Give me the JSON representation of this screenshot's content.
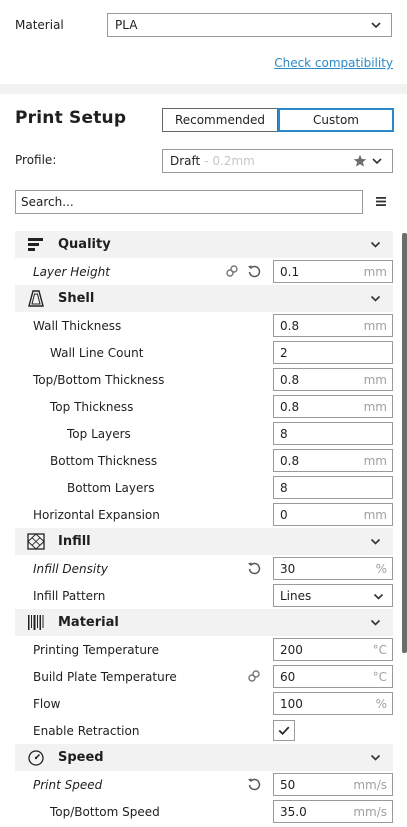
{
  "material": {
    "label": "Material",
    "value": "PLA",
    "check_link": "Check compatibility"
  },
  "print_setup": {
    "title": "Print Setup",
    "tabs": {
      "recommended": "Recommended",
      "custom": "Custom"
    }
  },
  "profile": {
    "label": "Profile:",
    "name": "Draft",
    "detail": "- 0.2mm"
  },
  "search": {
    "placeholder": "Search..."
  },
  "colors": {
    "accent": "#2a8ac6",
    "category_bg": "#f2f2f2",
    "border": "#9a9a9a"
  },
  "categories": {
    "quality": {
      "label": "Quality",
      "icon": "quality-icon",
      "settings": {
        "layer_height": {
          "label": "Layer Height",
          "value": "0.1",
          "unit": "mm"
        }
      }
    },
    "shell": {
      "label": "Shell",
      "icon": "shell-icon",
      "settings": {
        "wall_thickness": {
          "label": "Wall Thickness",
          "value": "0.8",
          "unit": "mm"
        },
        "wall_line_count": {
          "label": "Wall Line Count",
          "value": "2",
          "unit": ""
        },
        "top_bottom_thickness": {
          "label": "Top/Bottom Thickness",
          "value": "0.8",
          "unit": "mm"
        },
        "top_thickness": {
          "label": "Top Thickness",
          "value": "0.8",
          "unit": "mm"
        },
        "top_layers": {
          "label": "Top Layers",
          "value": "8",
          "unit": ""
        },
        "bottom_thickness": {
          "label": "Bottom Thickness",
          "value": "0.8",
          "unit": "mm"
        },
        "bottom_layers": {
          "label": "Bottom Layers",
          "value": "8",
          "unit": ""
        },
        "horizontal_expansion": {
          "label": "Horizontal Expansion",
          "value": "0",
          "unit": "mm"
        }
      }
    },
    "infill": {
      "label": "Infill",
      "icon": "infill-icon",
      "settings": {
        "infill_density": {
          "label": "Infill Density",
          "value": "30",
          "unit": "%"
        },
        "infill_pattern": {
          "label": "Infill Pattern",
          "value": "Lines"
        }
      }
    },
    "material": {
      "label": "Material",
      "icon": "material-icon",
      "settings": {
        "printing_temperature": {
          "label": "Printing Temperature",
          "value": "200",
          "unit": "°C"
        },
        "build_plate_temperature": {
          "label": "Build Plate Temperature",
          "value": "60",
          "unit": "°C"
        },
        "flow": {
          "label": "Flow",
          "value": "100",
          "unit": "%"
        },
        "enable_retraction": {
          "label": "Enable Retraction",
          "checked": true
        }
      }
    },
    "speed": {
      "label": "Speed",
      "icon": "speed-icon",
      "settings": {
        "print_speed": {
          "label": "Print Speed",
          "value": "50",
          "unit": "mm/s"
        },
        "top_bottom_speed": {
          "label": "Top/Bottom Speed",
          "value": "35.0",
          "unit": "mm/s"
        }
      }
    }
  }
}
